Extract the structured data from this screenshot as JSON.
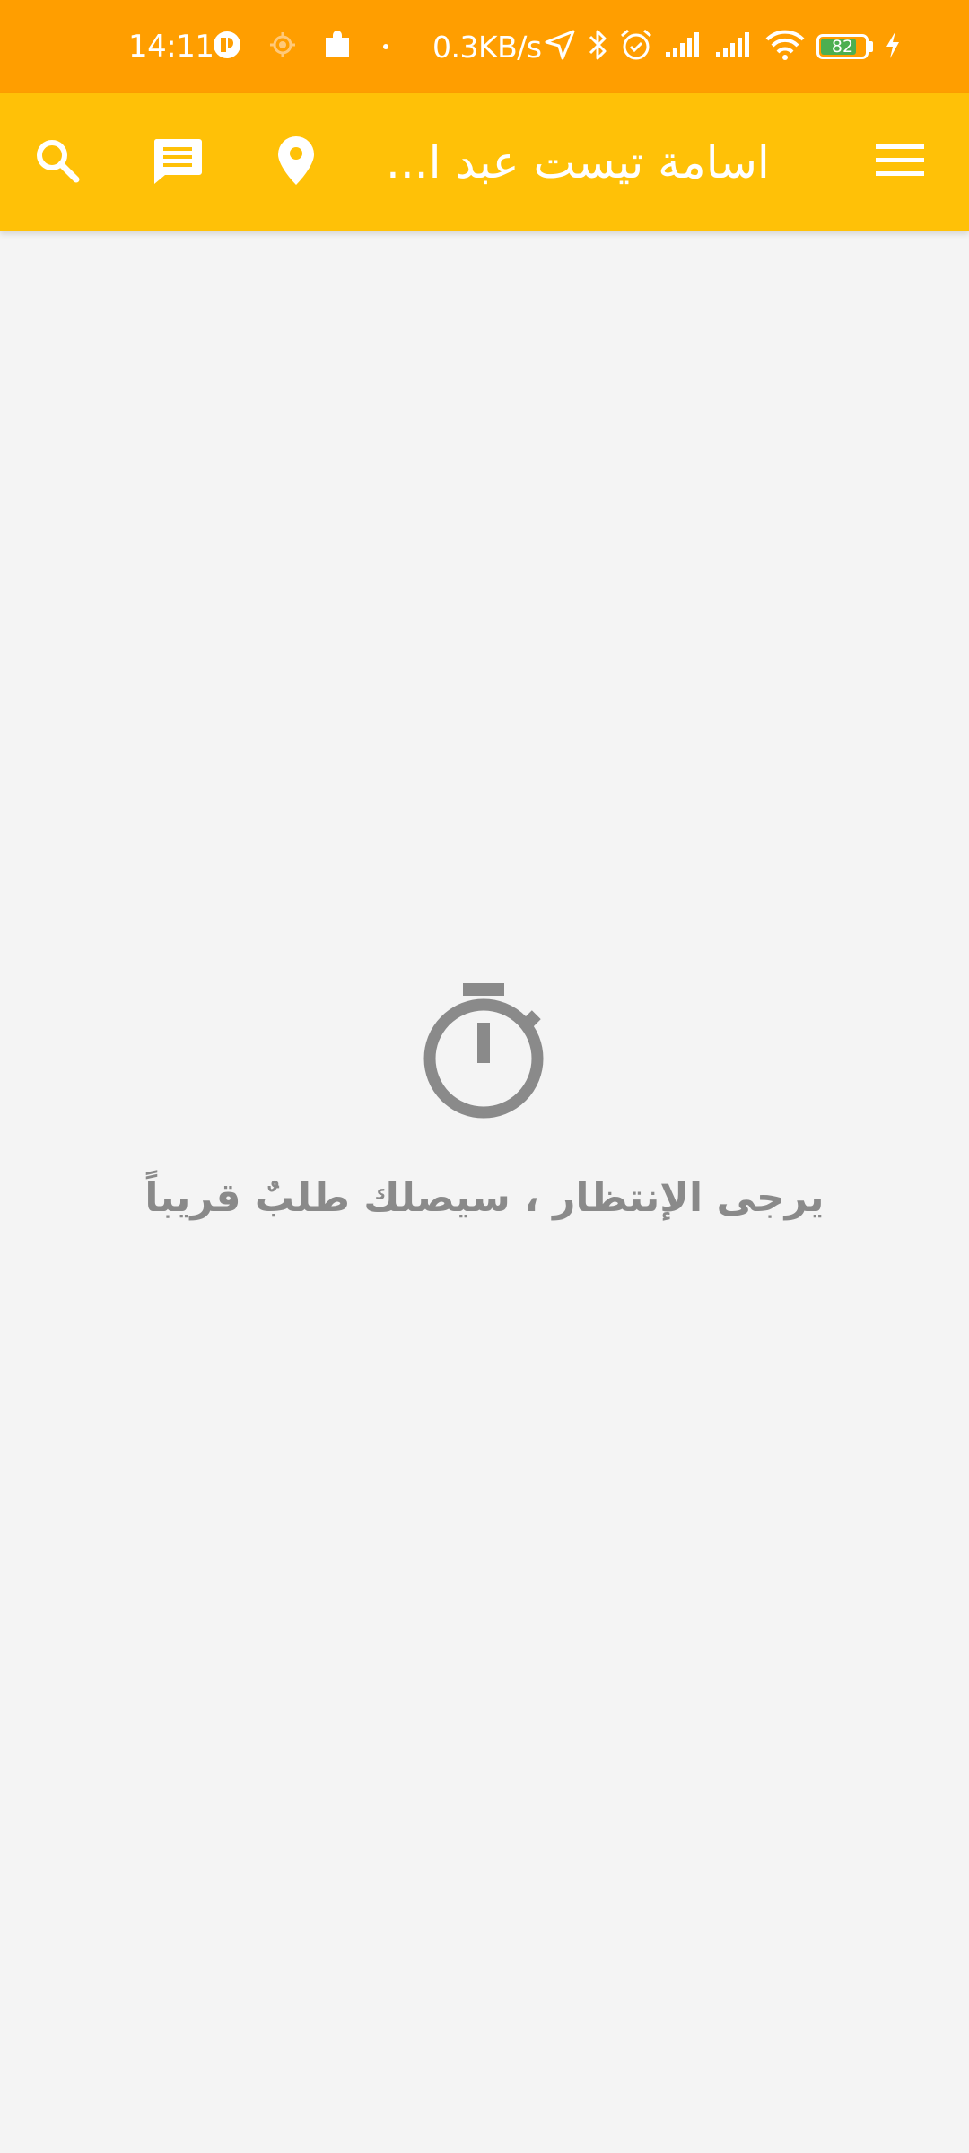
{
  "status_bar": {
    "time": "14:11",
    "network_speed": "0.3KB/s",
    "battery_level": "82",
    "battery_fraction": 0.82,
    "battery_color": "#4caf50",
    "left_icons": [
      "app-notification-icon",
      "location-target-icon",
      "puzzle-icon",
      "dot-icon"
    ],
    "right_icons": [
      "navigation-arrow-icon",
      "bluetooth-icon",
      "alarm-icon",
      "signal-icon",
      "signal-icon",
      "wifi-icon",
      "battery-icon",
      "charging-bolt-icon"
    ]
  },
  "app_bar": {
    "title": "اسامة تيست عبد ا...",
    "color": "#ffc107",
    "actions": [
      "menu-icon",
      "map-pin-icon",
      "chat-icon",
      "search-icon"
    ]
  },
  "empty_state": {
    "icon": "stopwatch-icon",
    "message": "يرجى الإنتظار ، سيصلك طلبٌ قريباً"
  },
  "colors": {
    "status_bar": "#ff9e00",
    "background": "#f4f4f4",
    "muted_text": "#8a8a8a"
  }
}
